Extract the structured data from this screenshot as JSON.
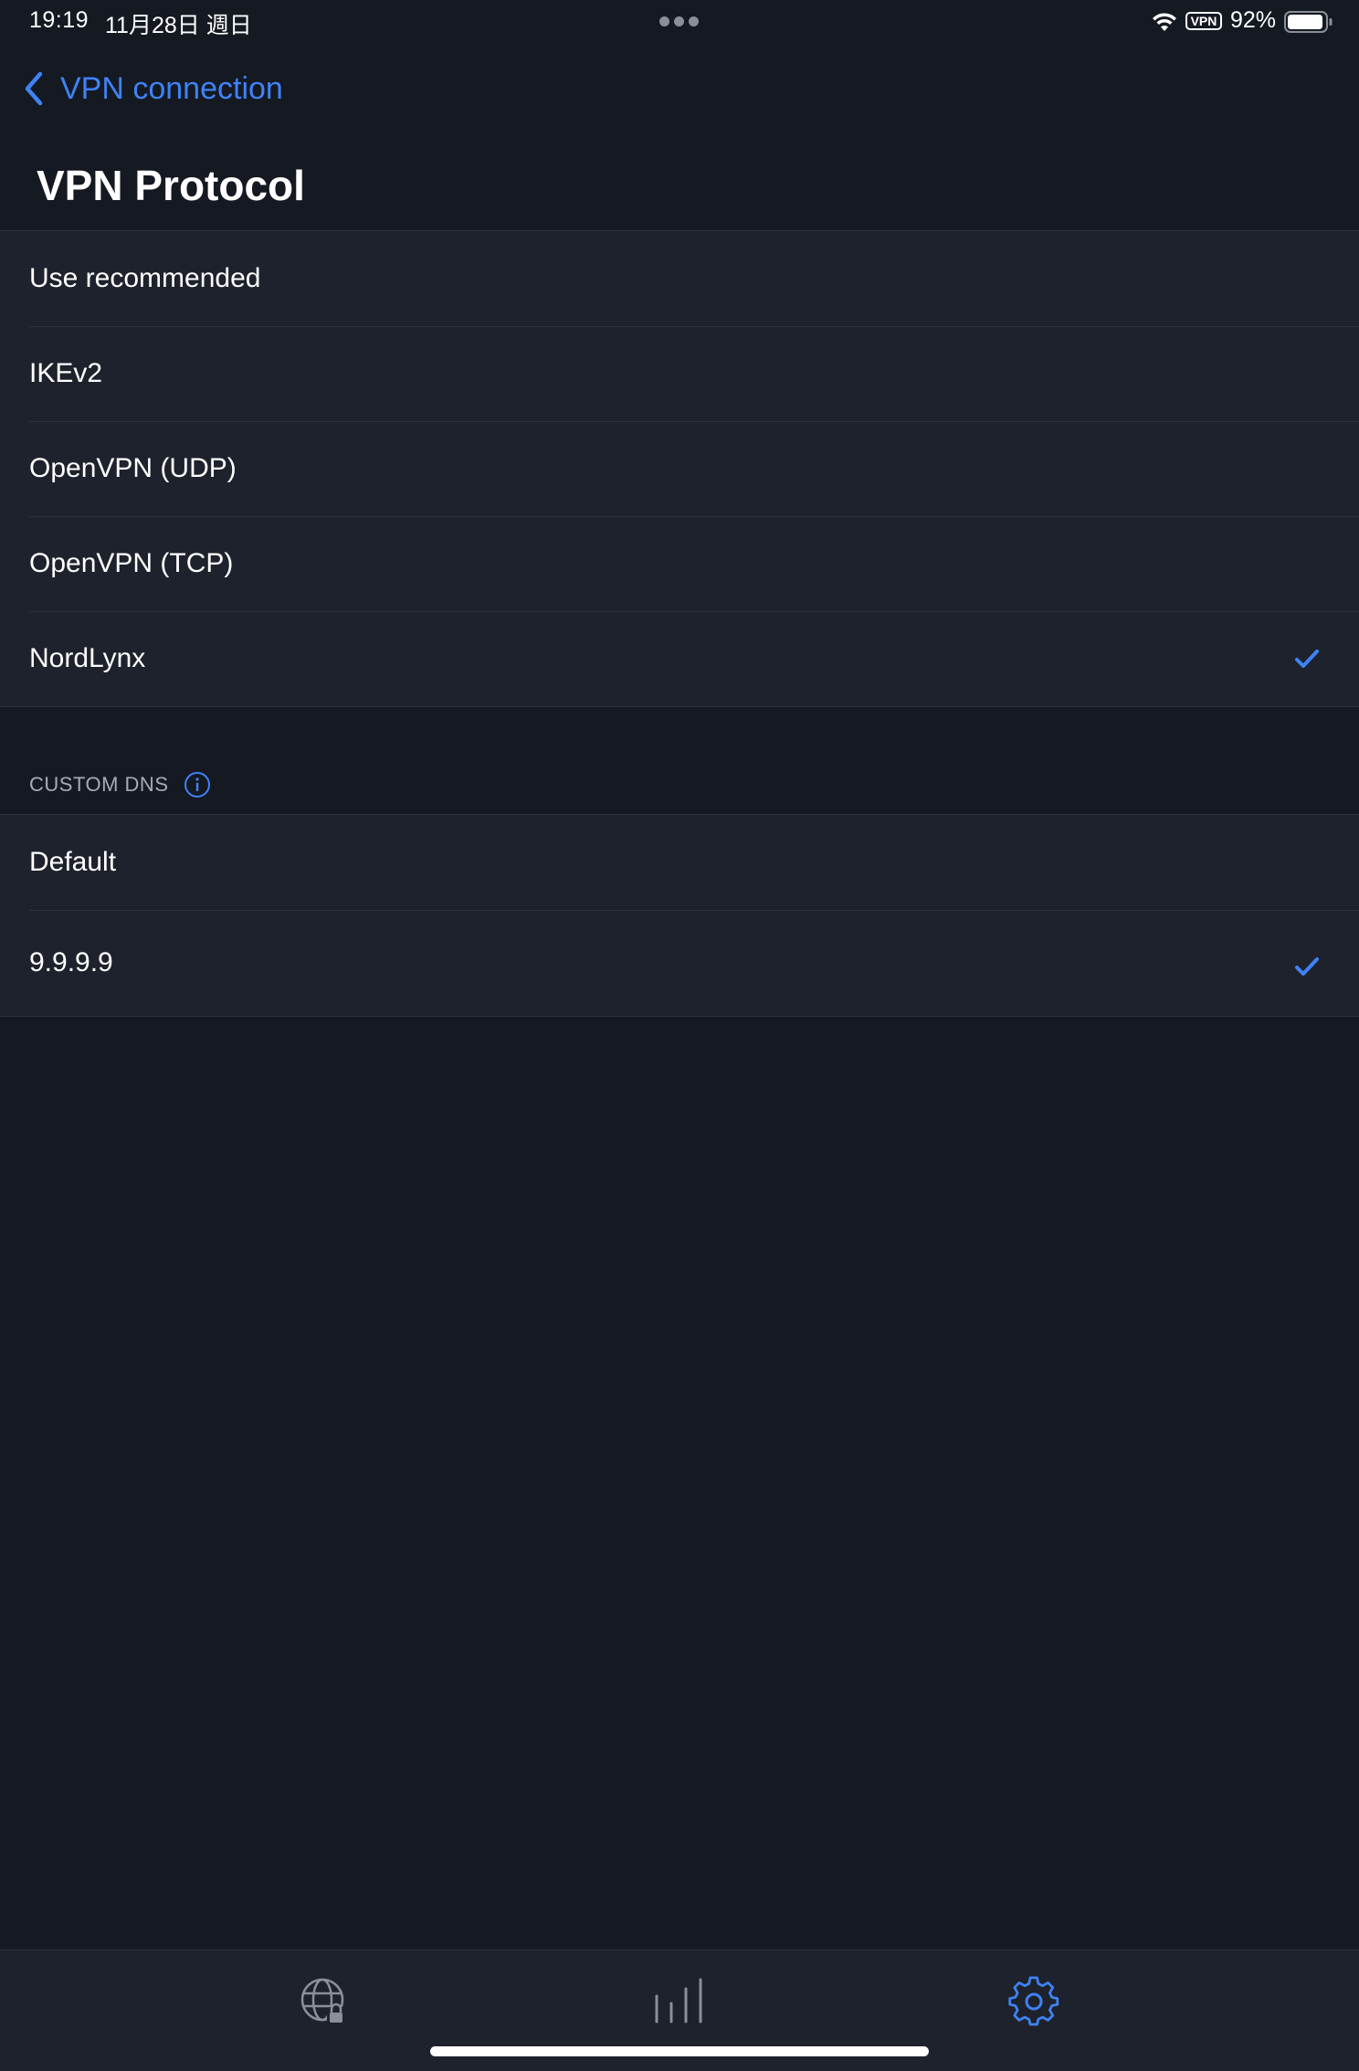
{
  "status_bar": {
    "time": "19:19",
    "date": "11月28日 週日",
    "vpn_badge": "VPN",
    "battery": "92%"
  },
  "nav": {
    "back_label": "VPN connection",
    "title": "VPN Protocol"
  },
  "protocols": {
    "items": [
      {
        "label": "Use recommended",
        "selected": false
      },
      {
        "label": "IKEv2",
        "selected": false
      },
      {
        "label": "OpenVPN (UDP)",
        "selected": false
      },
      {
        "label": "OpenVPN (TCP)",
        "selected": false
      },
      {
        "label": "NordLynx",
        "selected": true
      }
    ]
  },
  "custom_dns": {
    "header": "CUSTOM DNS",
    "items": [
      {
        "label": "Default",
        "selected": false
      },
      {
        "label": "9.9.9.9",
        "selected": true
      }
    ]
  },
  "tab_bar": {
    "tabs": [
      {
        "icon": "globe-lock-icon",
        "active": false
      },
      {
        "icon": "stats-bars-icon",
        "active": false
      },
      {
        "icon": "gear-icon",
        "active": true
      }
    ]
  },
  "colors": {
    "accent": "#3f82f5",
    "background": "#151922",
    "row_background": "#1e222c",
    "inactive_icon": "#8a8f98"
  }
}
